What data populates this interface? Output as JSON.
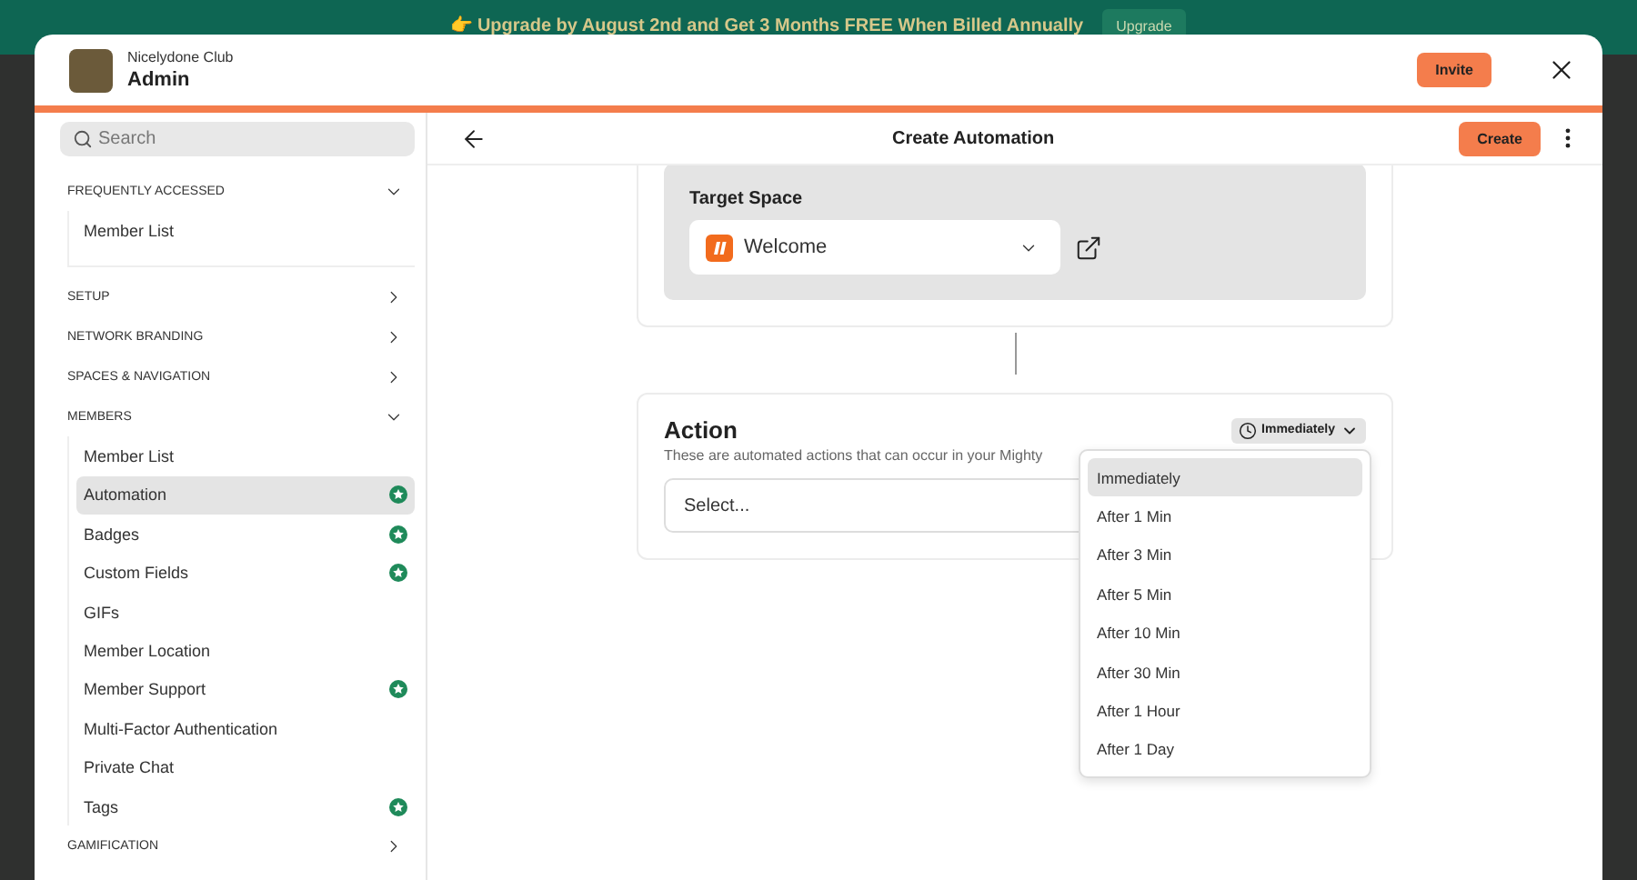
{
  "banner": {
    "text": "👉 Upgrade by August 2nd and Get 3 Months FREE When Billed Annually",
    "button": "Upgrade"
  },
  "header": {
    "network": "Nicelydone Club",
    "title": "Admin",
    "invite": "Invite"
  },
  "sidebar": {
    "search": {
      "placeholder": "Search"
    },
    "sections": [
      {
        "label": "FREQUENTLY ACCESSED",
        "expanded": true,
        "items": [
          {
            "label": "Member List",
            "selected": false,
            "featured": false
          }
        ]
      },
      {
        "label": "SETUP",
        "expanded": false
      },
      {
        "label": "NETWORK BRANDING",
        "expanded": false
      },
      {
        "label": "SPACES & NAVIGATION",
        "expanded": false
      },
      {
        "label": "MEMBERS",
        "expanded": true,
        "items": [
          {
            "label": "Member List",
            "selected": false,
            "featured": false
          },
          {
            "label": "Automation",
            "selected": true,
            "featured": true
          },
          {
            "label": "Badges",
            "selected": false,
            "featured": true
          },
          {
            "label": "Custom Fields",
            "selected": false,
            "featured": true
          },
          {
            "label": "GIFs",
            "selected": false,
            "featured": false
          },
          {
            "label": "Member Location",
            "selected": false,
            "featured": false
          },
          {
            "label": "Member Support",
            "selected": false,
            "featured": true
          },
          {
            "label": "Multi-Factor Authentication",
            "selected": false,
            "featured": false
          },
          {
            "label": "Private Chat",
            "selected": false,
            "featured": false
          },
          {
            "label": "Tags",
            "selected": false,
            "featured": true
          }
        ]
      },
      {
        "label": "GAMIFICATION",
        "expanded": false
      }
    ]
  },
  "content": {
    "title": "Create Automation",
    "create": "Create",
    "target_space": {
      "label": "Target Space",
      "value": "Welcome"
    },
    "action": {
      "title": "Action",
      "description": "These are automated actions that can occur in your Mighty",
      "placeholder": "Select...",
      "timing": {
        "value": "Immediately",
        "expanded": true,
        "options": [
          {
            "label": "Immediately",
            "selected": true
          },
          {
            "label": "After 1 Min",
            "selected": false
          },
          {
            "label": "After 3 Min",
            "selected": false
          },
          {
            "label": "After 5 Min",
            "selected": false
          },
          {
            "label": "After 10 Min",
            "selected": false
          },
          {
            "label": "After 30 Min",
            "selected": false
          },
          {
            "label": "After 1 Hour",
            "selected": false
          },
          {
            "label": "After 1 Day",
            "selected": false
          }
        ]
      }
    }
  }
}
